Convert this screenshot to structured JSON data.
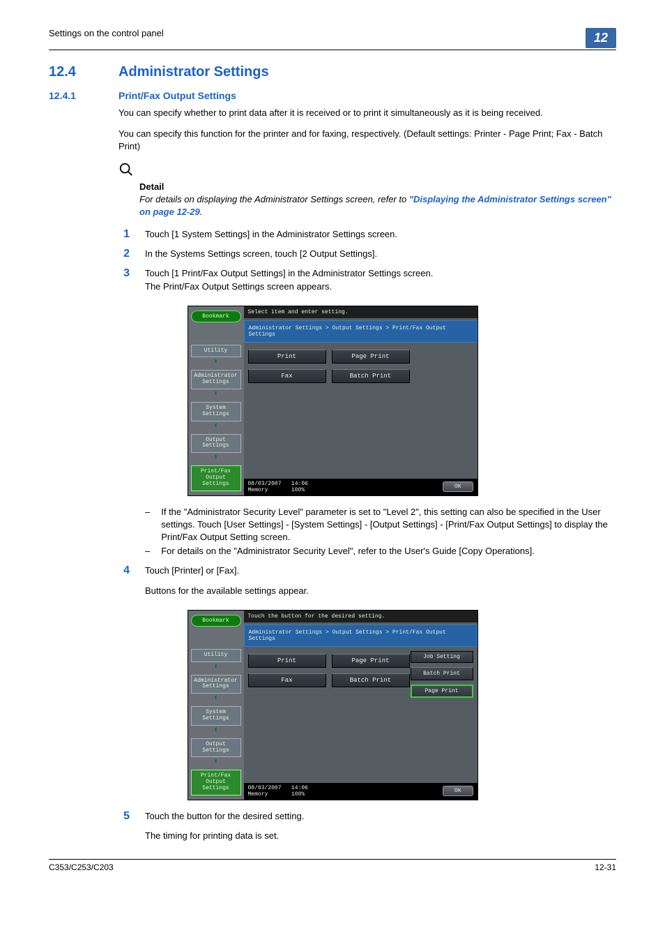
{
  "header": {
    "section_path": "Settings on the control panel",
    "chapter": "12"
  },
  "section": {
    "number": "12.4",
    "title": "Administrator Settings"
  },
  "subsection": {
    "number": "12.4.1",
    "title": "Print/Fax Output Settings"
  },
  "paragraphs": {
    "p1": "You can specify whether to print data after it is received or to print it simultaneously as it is being received.",
    "p2": "You can specify this function for the printer and for faxing, respectively. (Default settings: Printer - Page Print; Fax - Batch Print)"
  },
  "detail": {
    "heading": "Detail",
    "pre": "For details on displaying the Administrator Settings screen, refer to ",
    "link": "\"Displaying the Administrator Settings screen\" on page 12-29",
    "post": "."
  },
  "steps": [
    {
      "n": "1",
      "text": "Touch [1 System Settings] in the Administrator Settings screen."
    },
    {
      "n": "2",
      "text": "In the Systems Settings screen, touch [2 Output Settings]."
    },
    {
      "n": "3",
      "text": "Touch [1 Print/Fax Output Settings] in the Administrator Settings screen.",
      "sub": "The Print/Fax Output Settings screen appears."
    },
    {
      "n": "4",
      "text": "Touch [Printer] or [Fax]."
    },
    {
      "n": "5",
      "text": "Touch the button for the desired setting.",
      "sub2": "The timing for printing data is set."
    }
  ],
  "bullets": [
    "If the \"Administrator Security Level\" parameter is set to \"Level 2\", this setting can also be specified in the User settings. Touch [User Settings] - [System Settings] - [Output Settings] - [Print/Fax Output Settings] to display the Print/Fax Output Setting screen.",
    "For details on the \"Administrator Security Level\", refer to the User's Guide [Copy Operations]."
  ],
  "step4_subtext": "Buttons for the available settings appear.",
  "shot": {
    "bookmark": "Bookmark",
    "prompt1": "Select item and enter setting.",
    "prompt2": "Touch the button for the desired setting.",
    "breadcrumb": "Administrator Settings > Output Settings > Print/Fax Output Settings",
    "labels": {
      "print": "Print",
      "fax": "Fax"
    },
    "values": {
      "page": "Page Print",
      "batch": "Batch Print"
    },
    "side": {
      "title": "Job Setting",
      "batch": "Batch Print",
      "page": "Page Print"
    },
    "nav": {
      "utility": "Utility",
      "admin": "Administrator\nSettings",
      "sys": "System Settings",
      "out": "Output Settings",
      "pf": "Print/Fax Output\nSettings"
    },
    "footer": {
      "date": "08/03/2007",
      "time": "14:06",
      "mem_label": "Memory",
      "mem_val": "100%",
      "ok": "OK"
    }
  },
  "footer": {
    "model": "C353/C253/C203",
    "page": "12-31"
  }
}
